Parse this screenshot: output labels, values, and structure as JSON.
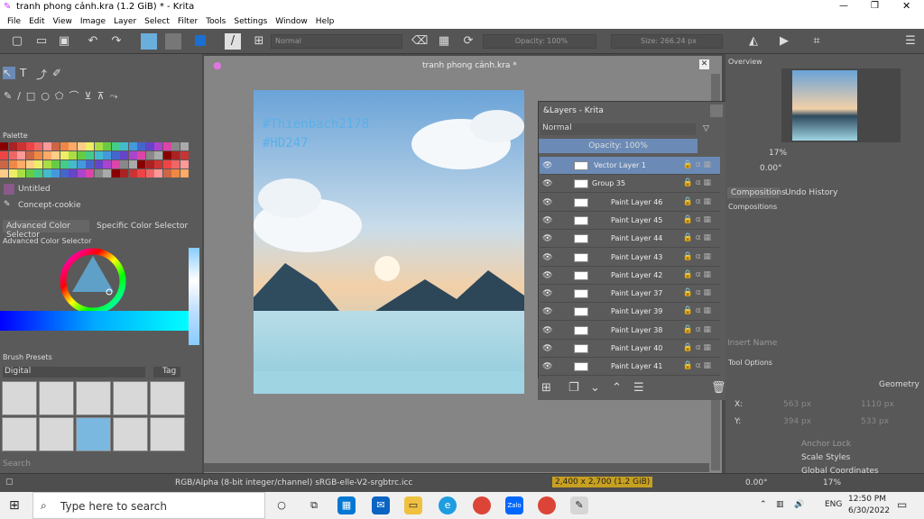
{
  "window": {
    "title": "tranh phong cảnh.kra (1.2 GiB)  * - Krita"
  },
  "menu": [
    "File",
    "Edit",
    "View",
    "Image",
    "Layer",
    "Select",
    "Filter",
    "Tools",
    "Settings",
    "Window",
    "Help"
  ],
  "toolbar": {
    "blend_mode": "Normal",
    "opacity": "Opacity: 100%",
    "size": "Size: 266.24 px"
  },
  "canvas": {
    "doc_title": "tranh phong cảnh.kra *",
    "handwritten": [
      "#Thienbach2178",
      "#HD247"
    ]
  },
  "left": {
    "palette_title": "Palette",
    "palette_name": "Untitled",
    "brush_name": "Concept-cookie",
    "tab_advanced": "Advanced Color Selector",
    "tab_specific": "Specific Color Selector",
    "adv_title": "Advanced Color Selector",
    "brush_presets": "Brush Presets",
    "preset_filter": "Digital",
    "tag": "Tag",
    "search": "Search"
  },
  "layers": {
    "title": "&Layers - Krita",
    "mode": "Normal",
    "opacity": "Opacity:  100%",
    "items": [
      "Vector Layer 1",
      "Group 35",
      "Paint Layer 46",
      "Paint Layer 45",
      "Paint Layer 44",
      "Paint Layer 43",
      "Paint Layer 42",
      "Paint Layer 37",
      "Paint Layer 39",
      "Paint Layer 38",
      "Paint Layer 40",
      "Paint Layer 41"
    ]
  },
  "right": {
    "overview": "Overview",
    "zoom": "17%",
    "rotation": "0.00°",
    "tab_compositions": "Compositions",
    "tab_undo": "Undo History",
    "compositions": "Compositions",
    "insert_name": "Insert Name",
    "tool_options": "Tool Options",
    "geometry": "Geometry",
    "x_label": "X:",
    "x_val": "563 px",
    "x_val2": "1110 px",
    "y_label": "Y:",
    "y_val": "394 px",
    "y_val2": "533 px",
    "anchor": "Anchor Lock",
    "scale": "Scale Styles",
    "global": "Global Coordinates"
  },
  "status": {
    "color_info": "RGB/Alpha (8-bit integer/channel)  sRGB-elle-V2-srgbtrc.icc",
    "dims": "2,400 x 2,700 (1.2 GiB)",
    "rotation": "0.00°",
    "zoom": "17%"
  },
  "taskbar": {
    "search": "Type here to search",
    "time": "12:50 PM",
    "date": "6/30/2022",
    "lang": "ENG"
  }
}
